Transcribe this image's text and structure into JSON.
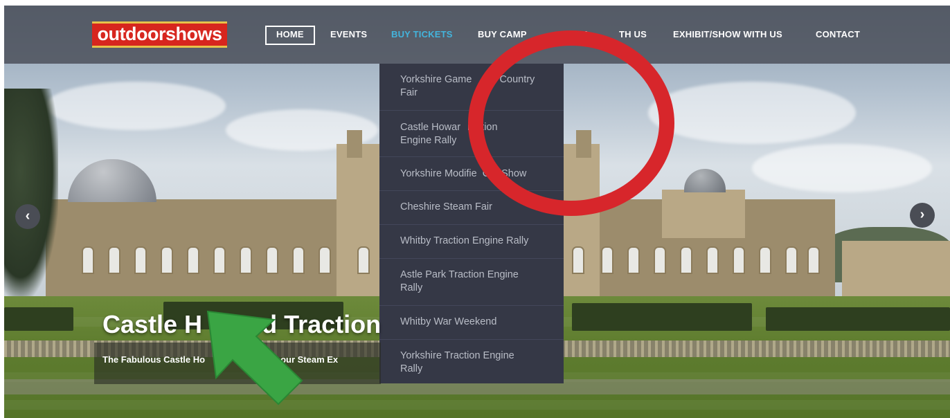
{
  "brand": {
    "logo_text": "outdoorshows",
    "logo_bg": "#d7261e",
    "logo_trim": "#e7c34a"
  },
  "nav": {
    "home": "HOME",
    "events": "EVENTS",
    "buy_tickets": "BUY TICKETS",
    "buy_camping": "BUY CAMP",
    "trade": "TRA",
    "trade_suffix": "TH US",
    "exhibit": "EXHIBIT/SHOW WITH US",
    "contact": "CONTACT",
    "accent_color": "#43b4dc"
  },
  "dropdown": {
    "items": [
      {
        "line1": "Yorkshire Game",
        "line1_tail": "d Country",
        "line2": "Fair"
      },
      {
        "line1": "Castle Howar",
        "line1_tail": "raction",
        "line2": "Engine Rally"
      },
      {
        "line1": "Yorkshire Modifie",
        "line1_tail": "Car Show",
        "line2": ""
      },
      {
        "line1": "Cheshire Steam Fair",
        "line1_tail": "",
        "line2": ""
      },
      {
        "line1": "Whitby Traction Engine Rally",
        "line1_tail": "",
        "line2": ""
      },
      {
        "line1": "Astle Park Traction Engine",
        "line1_tail": "",
        "line2": "Rally"
      },
      {
        "line1": "Whitby War Weekend",
        "line1_tail": "",
        "line2": ""
      },
      {
        "line1": "Yorkshire Traction Engine",
        "line1_tail": "",
        "line2": "Rally"
      }
    ]
  },
  "slide": {
    "title_part1": "Castle H",
    "title_part2": "ard Traction",
    "subtitle_part1": "The Fabulous Castle Ho",
    "subtitle_part2": "ost to our Steam Ex"
  },
  "slider": {
    "prev_icon": "chevron-left-icon",
    "next_icon": "chevron-right-icon",
    "prev_glyph": "‹",
    "next_glyph": "›"
  },
  "annotations": {
    "circle_color": "#d7262b",
    "arrow_color": "#3aa544"
  }
}
